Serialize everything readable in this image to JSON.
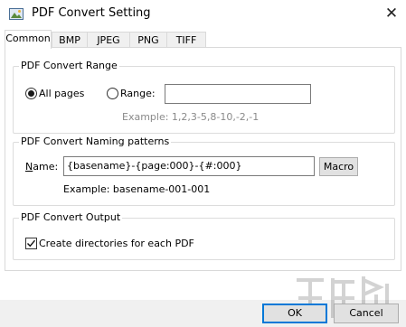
{
  "window": {
    "title": "PDF Convert Setting",
    "icon": "picture-icon",
    "close_glyph": "✕"
  },
  "tabs": [
    {
      "label": "Common",
      "active": true
    },
    {
      "label": "BMP",
      "active": false
    },
    {
      "label": "JPEG",
      "active": false
    },
    {
      "label": "PNG",
      "active": false
    },
    {
      "label": "TIFF",
      "active": false
    }
  ],
  "range_group": {
    "title": "PDF Convert Range",
    "all_pages_label": "All pages",
    "all_pages_selected": true,
    "range_label": "Range:",
    "range_selected": false,
    "range_value": "",
    "example": "Example: 1,2,3-5,8-10,-2,-1"
  },
  "naming_group": {
    "title": "PDF Convert Naming patterns",
    "name_label_prefix": "N",
    "name_label_rest": "ame:",
    "name_value": "{basename}-{page:000}-{#:000}",
    "macro_label": "Macro",
    "example": "Example:  basename-001-001"
  },
  "output_group": {
    "title": "PDF Convert Output",
    "create_dirs_label": "Create directories for each PDF",
    "create_dirs_checked": true
  },
  "footer": {
    "ok_label": "OK",
    "cancel_label": "Cancel"
  }
}
